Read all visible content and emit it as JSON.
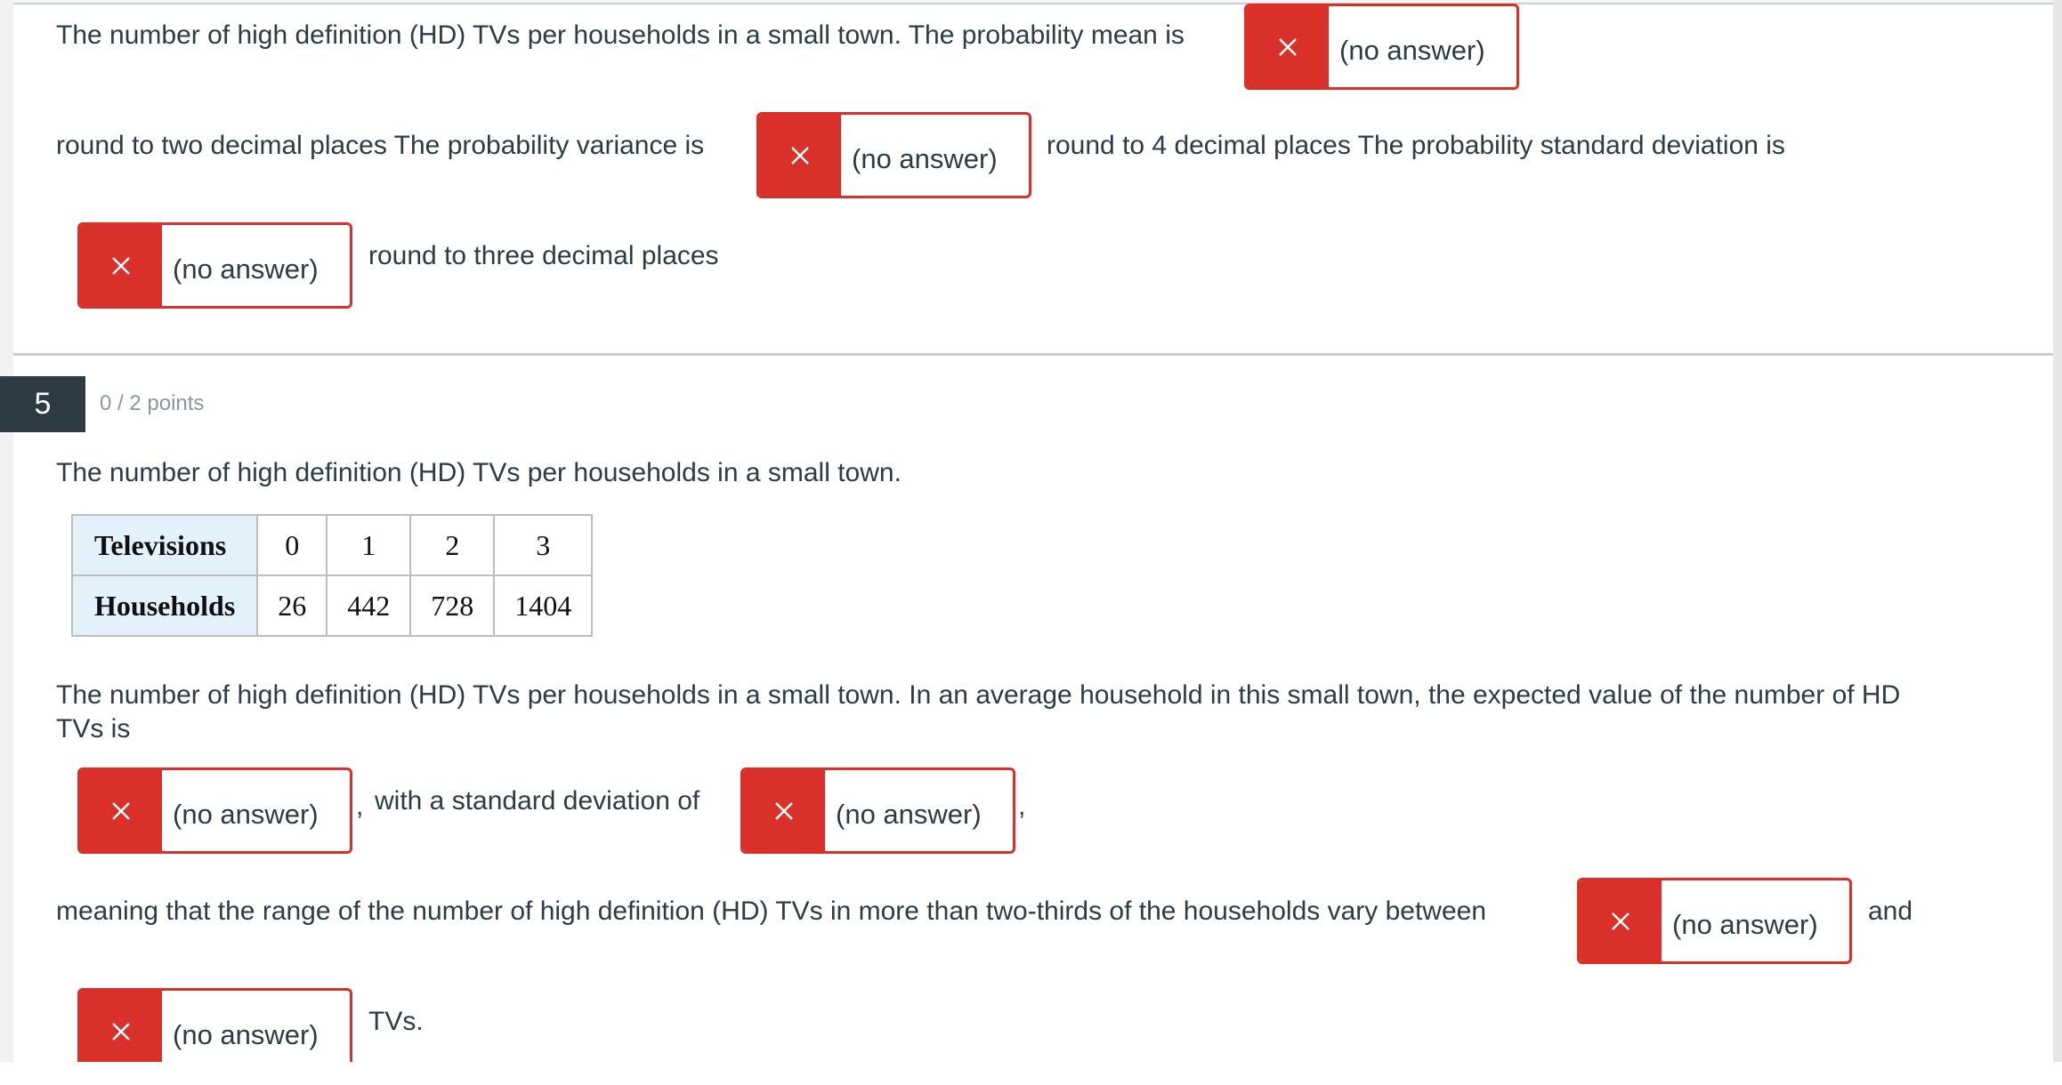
{
  "previous_question": {
    "text_mean": "The number of high definition (HD) TVs per households in a small town. The probability mean is",
    "text_variance": "round to two decimal places The probability variance is",
    "text_sd": "round to 4 decimal places The probability standard deviation is",
    "text_end": "round to three decimal places",
    "answers": {
      "mean": "(no answer)",
      "variance": "(no answer)",
      "sd": "(no answer)"
    }
  },
  "question": {
    "number": "5",
    "points": "0 / 2 points",
    "intro": "The number of high definition (HD) TVs per households in a small town.",
    "table": {
      "rows": [
        {
          "header": "Televisions",
          "cells": [
            "0",
            "1",
            "2",
            "3"
          ]
        },
        {
          "header": "Households",
          "cells": [
            "26",
            "442",
            "728",
            "1404"
          ]
        }
      ]
    },
    "paragraph_line1": "The number of high definition (HD) TVs per households in a small town. In an average household in this small town, the expected value of the number of HD",
    "paragraph_line2": "TVs is",
    "comma1": ",",
    "with_sd": "with a standard deviation of",
    "comma2": ",",
    "range_text": "meaning that the range of the number of high definition (HD) TVs in more than two-thirds of the households vary between",
    "and": "and",
    "tvs_end": "TVs.",
    "answers": {
      "expected_value": "(no answer)",
      "standard_deviation": "(no answer)",
      "range_low": "(no answer)",
      "range_high": "(no answer)"
    }
  },
  "colors": {
    "incorrect": "#d9302a",
    "text": "#2d3b45",
    "badge": "#2d3b45",
    "points": "#8b969e",
    "table_header": "#e2f1fa"
  },
  "icons": {
    "incorrect_mark": "close-x-icon"
  }
}
